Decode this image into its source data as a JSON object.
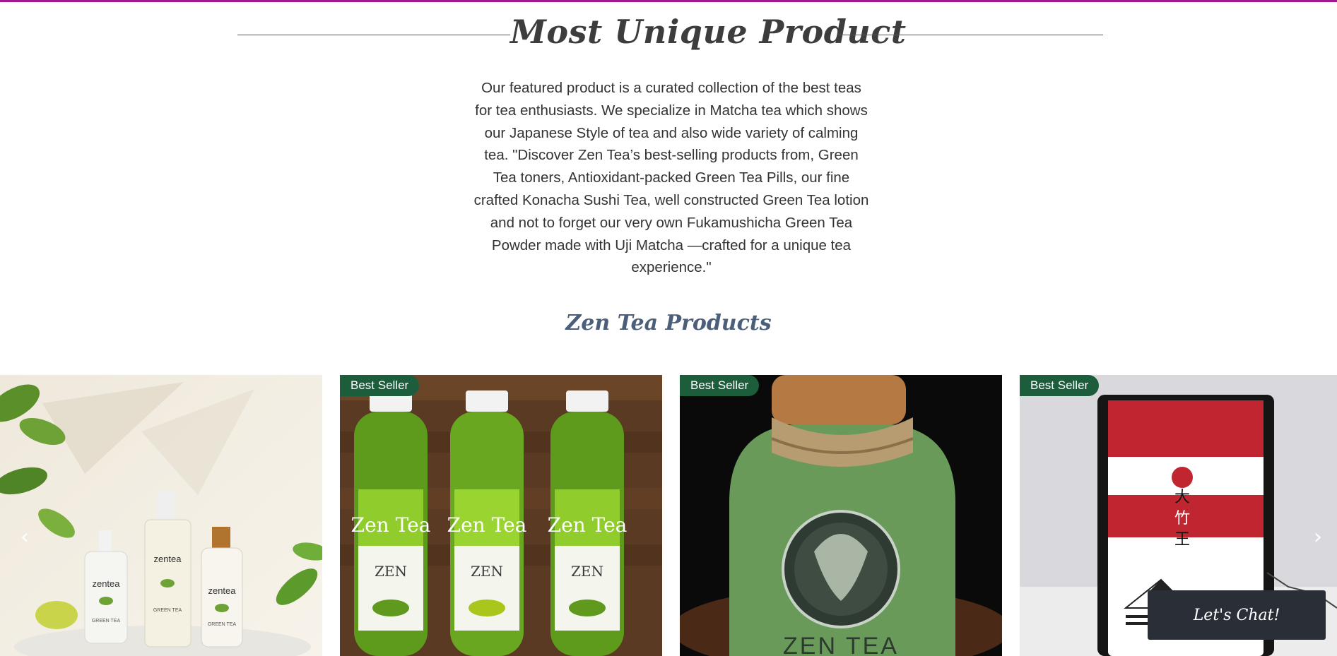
{
  "hero": {
    "title": "Most Unique Product",
    "description": "Our featured product is a curated collection of the best teas for tea enthusiasts. We specialize in Matcha tea which shows our Japanese Style of tea and also wide variety of calming tea. \"Discover Zen Tea’s best-selling products from, Green Tea toners, Antioxidant-packed Green Tea Pills, our fine crafted Konacha Sushi Tea, well constructed Green Tea lotion and not to forget our very own  Fukamushicha Green Tea Powder made with Uji Matcha —crafted for a unique tea experience.\""
  },
  "products": {
    "heading": "Zen Tea Products",
    "items": [
      {
        "badge": "",
        "image_label": "zentea",
        "image_sub": "GREEN TEA"
      },
      {
        "badge": "Best Seller",
        "image_label": "Zen Tea",
        "image_sub": "ZEN"
      },
      {
        "badge": "Best Seller",
        "image_label": "ZEN TEA"
      },
      {
        "badge": "Best Seller",
        "image_label": ""
      }
    ],
    "prev_icon": "chevron-left-icon",
    "next_icon": "chevron-right-icon",
    "prev_glyph": "‹",
    "next_glyph": "›"
  },
  "chat": {
    "label": "Let's Chat!"
  },
  "colors": {
    "accent_bar": "#a3188f",
    "badge_bg": "#1c5e3b",
    "chat_bg": "#2a2e36",
    "heading_blue": "#4b5f7a"
  }
}
